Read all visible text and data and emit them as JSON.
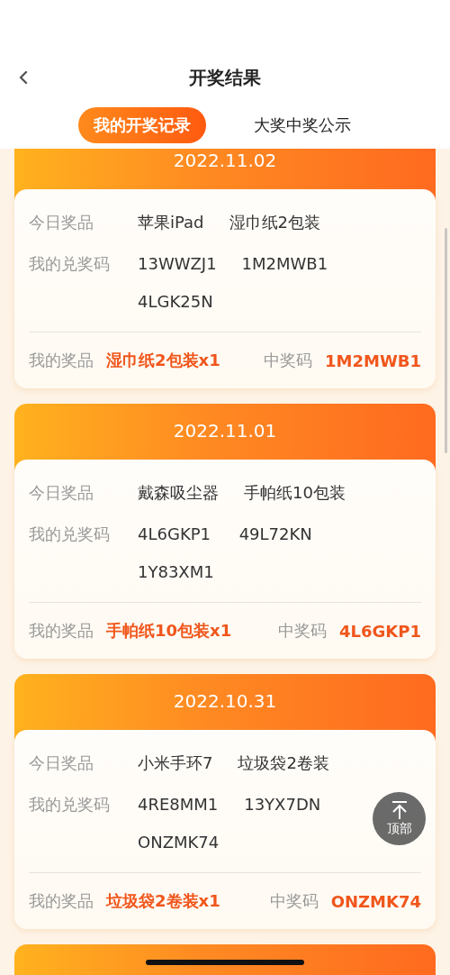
{
  "nav": {
    "title": "开奖结果"
  },
  "tabs": [
    {
      "label": "我的开奖记录",
      "selected": true
    },
    {
      "label": "大奖中奖公示",
      "selected": false
    }
  ],
  "records": [
    {
      "date": "2022.11.02",
      "prizes_label": "今日奖品",
      "prizes": [
        "苹果iPad",
        "湿巾纸2包装"
      ],
      "codes_label": "我的兑奖码",
      "codes": [
        "13WWZJ1",
        "1M2MWB1",
        "4LGK25N"
      ],
      "my_prize_label": "我的奖品",
      "my_prize": "湿巾纸2包装x1",
      "winning_code_label": "中奖码",
      "winning_code": "1M2MWB1"
    },
    {
      "date": "2022.11.01",
      "prizes_label": "今日奖品",
      "prizes": [
        "戴森吸尘器",
        "手帕纸10包装"
      ],
      "codes_label": "我的兑奖码",
      "codes": [
        "4L6GKP1",
        "49L72KN",
        "1Y83XM1"
      ],
      "my_prize_label": "我的奖品",
      "my_prize": "手帕纸10包装x1",
      "winning_code_label": "中奖码",
      "winning_code": "4L6GKP1"
    },
    {
      "date": "2022.10.31",
      "prizes_label": "今日奖品",
      "prizes": [
        "小米手环7",
        "垃圾袋2卷装"
      ],
      "codes_label": "我的兑奖码",
      "codes": [
        "4RE8MM1",
        "13YX7DN",
        "ONZMK74"
      ],
      "my_prize_label": "我的奖品",
      "my_prize": "垃圾袋2卷装x1",
      "winning_code_label": "中奖码",
      "winning_code": "ONZMK74"
    },
    {
      "kind": "cut_off"
    }
  ],
  "back_to_top": {
    "label": "顶部"
  }
}
